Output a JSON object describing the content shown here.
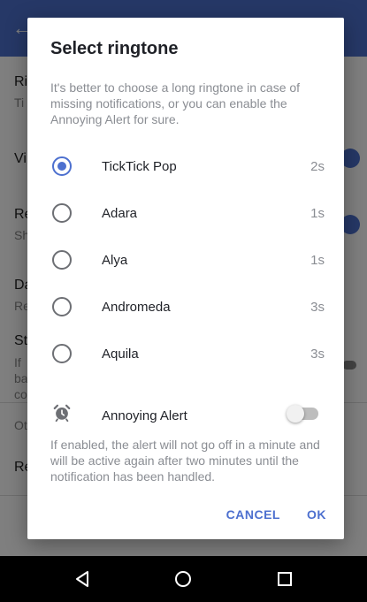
{
  "colors": {
    "accent": "#4d70cf",
    "title_text": "#1f2127",
    "secondary_text": "#8a8d93",
    "scrim": "rgba(0,0,0,0.5)",
    "nav_background": "#000000"
  },
  "background_app": {
    "back_icon": "arrow-back-icon",
    "rows": [
      {
        "label": "Ri",
        "sub": "Ti"
      },
      {
        "label": "Vi",
        "sub": ""
      },
      {
        "label": "Re",
        "sub": "Sh"
      },
      {
        "label": "Da",
        "sub": "Re"
      },
      {
        "label": "St",
        "sub": "If ba co"
      },
      {
        "label": "Ot",
        "sub": ""
      },
      {
        "label": "Re",
        "sub": ""
      }
    ]
  },
  "dialog": {
    "title": "Select ringtone",
    "description": "It's better to choose a long ringtone in case of missing notifications, or you can enable the Annoying Alert for sure.",
    "ringtones": [
      {
        "name": "TickTick Pop",
        "duration": "2s",
        "selected": true
      },
      {
        "name": "Adara",
        "duration": "1s",
        "selected": false
      },
      {
        "name": "Alya",
        "duration": "1s",
        "selected": false
      },
      {
        "name": "Andromeda",
        "duration": "3s",
        "selected": false
      },
      {
        "name": "Aquila",
        "duration": "3s",
        "selected": false
      }
    ],
    "annoying_alert": {
      "icon": "alarm-clock-icon",
      "label": "Annoying Alert",
      "enabled": false,
      "note": "If enabled, the alert will not go off in a minute and will be active again after two minutes until the notification has been handled."
    },
    "actions": {
      "cancel": "CANCEL",
      "ok": "OK"
    }
  },
  "navbar": {
    "buttons": [
      "back-triangle-icon",
      "home-circle-icon",
      "recents-square-icon"
    ]
  }
}
